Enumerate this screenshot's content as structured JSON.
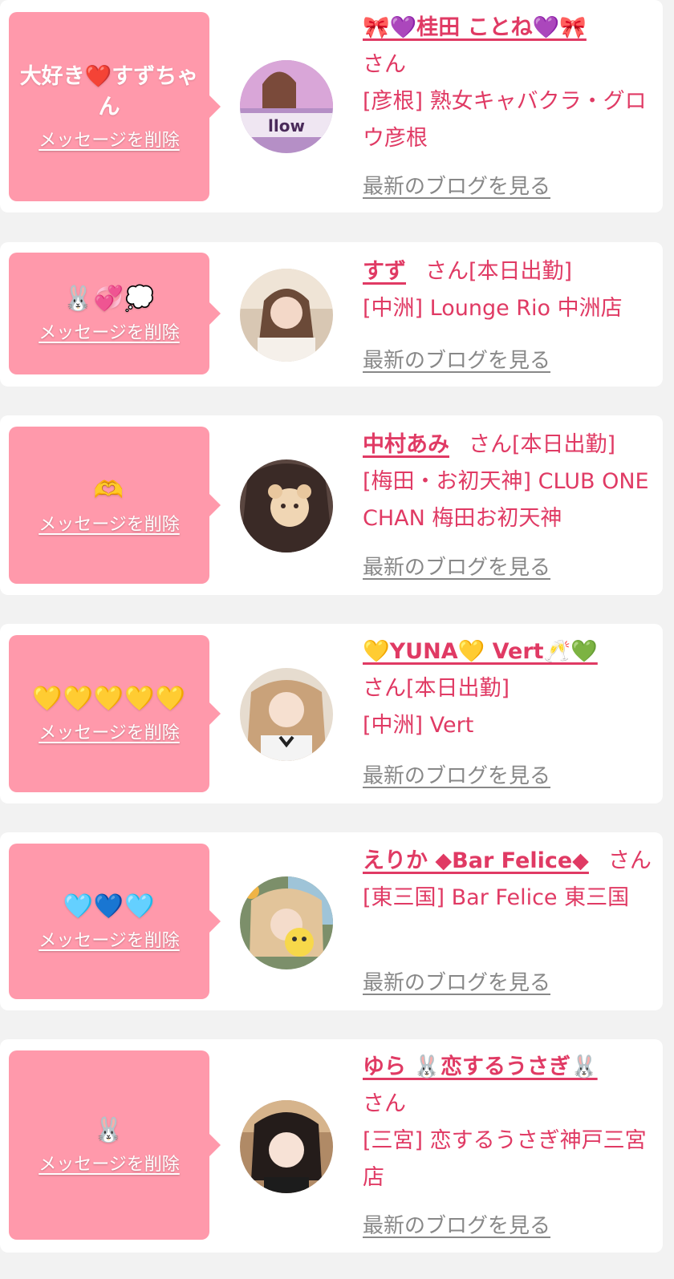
{
  "colors": {
    "page_bg": "#f2f2f2",
    "card_bg": "#ffffff",
    "bubble_bg": "#ff99ab",
    "accent": "#e03a64",
    "link_gray": "#888888"
  },
  "items": [
    {
      "message": "大好き❤️すずちゃん",
      "delete_label": "メッセージを削除",
      "name": "🎀💜桂田 ことね💜🎀",
      "san": "さん",
      "status": "",
      "shop": "[彦根] 熟女キャバクラ・グロウ彦根",
      "blog_label": "最新のブログを見る",
      "avatar_icon": "shop-logo-avatar"
    },
    {
      "message": "🐰💞💭",
      "delete_label": "メッセージを削除",
      "name": "すず",
      "san": "さん",
      "status": "[本日出勤]",
      "shop": "[中洲] Lounge Rio 中洲店",
      "blog_label": "最新のブログを見る",
      "avatar_icon": "profile-photo-avatar"
    },
    {
      "message": "🫶",
      "delete_label": "メッセージを削除",
      "name": "中村あみ",
      "san": "さん",
      "status": "[本日出勤]",
      "shop": "[梅田・お初天神] CLUB ONE CHAN 梅田お初天神",
      "blog_label": "最新のブログを見る",
      "avatar_icon": "profile-photo-avatar"
    },
    {
      "message": "💛💛💛💛💛",
      "delete_label": "メッセージを削除",
      "name": "💛YUNA💛 Vert🥂💚",
      "san": "さん",
      "status": "[本日出勤]",
      "shop": "[中洲] Vert",
      "blog_label": "最新のブログを見る",
      "avatar_icon": "profile-photo-avatar"
    },
    {
      "message": "🩵💙🩵",
      "delete_label": "メッセージを削除",
      "name": "えりか ◆Bar Felice◆",
      "san": "さん",
      "status": "",
      "shop": "[東三国] Bar Felice 東三国",
      "blog_label": "最新のブログを見る",
      "avatar_icon": "profile-photo-avatar"
    },
    {
      "message": "🐰",
      "delete_label": "メッセージを削除",
      "name": "ゆら 🐰恋するうさぎ🐰",
      "san": "さん",
      "status": "",
      "shop": "[三宮] 恋するうさぎ神戸三宮店",
      "blog_label": "最新のブログを見る",
      "avatar_icon": "profile-photo-avatar"
    }
  ]
}
